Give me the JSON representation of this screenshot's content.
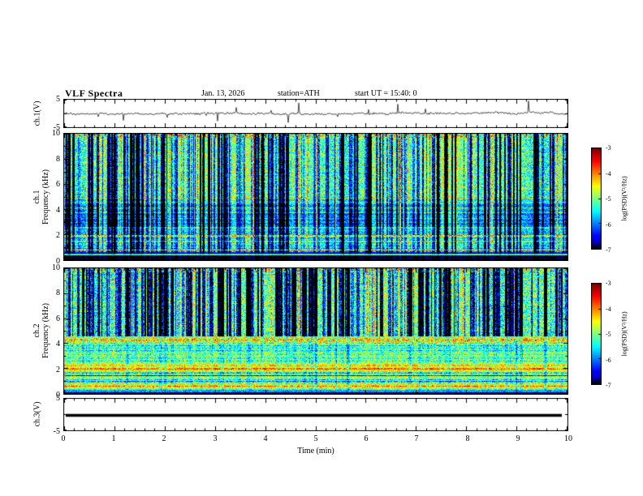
{
  "header": {
    "title": "VLF Spectra",
    "date": "Jan. 13, 2026",
    "station": "station=ATH",
    "start_ut": "start UT =  15:40: 0"
  },
  "xaxis": {
    "label": "Time (min)",
    "ticks": [
      "0",
      "1",
      "2",
      "3",
      "4",
      "5",
      "6",
      "7",
      "8",
      "9",
      "10"
    ],
    "range": [
      0,
      10
    ]
  },
  "panel_ch1v": {
    "label": "ch.1(V)",
    "ytop": "5",
    "ybottom": "-5"
  },
  "panel_spec1": {
    "label_ch": "ch.1",
    "label_freq": "Frequency (kHz)",
    "yticks": [
      "10",
      "8",
      "6",
      "4",
      "2",
      "0"
    ]
  },
  "panel_spec2": {
    "label_ch": "ch.2",
    "label_freq": "Frequency (kHz)",
    "yticks": [
      "10",
      "8",
      "6",
      "4",
      "2",
      "0"
    ]
  },
  "panel_ch3v": {
    "label": "ch.3(V)",
    "ytop": "5",
    "ybottom": "-5"
  },
  "colorbar": {
    "label": "log(PSD)(V²/Hz)",
    "ticks": [
      "-3",
      "-4",
      "-5",
      "-6",
      "-7"
    ],
    "colormap": "jet",
    "zlim": [
      -7,
      -3
    ]
  },
  "chart_data": [
    {
      "type": "line",
      "name": "ch1-voltage-waveform",
      "ylabel": "ch.1(V)",
      "xlabel": "Time (min)",
      "xlim": [
        0,
        10
      ],
      "ylim": [
        -5,
        5
      ],
      "description": "Broadband noisy voltage trace centered on 0 V with intermittent impulsive spikes reaching about ±4 V over 0–10 min",
      "render": {
        "seed": 20260113,
        "noise": 0.32,
        "wander": 0.28,
        "spike_prob": 0.02,
        "spike_amp": 3.4
      }
    },
    {
      "type": "heatmap",
      "name": "ch1-spectrogram",
      "ylabel": "Frequency (kHz)",
      "zlabel": "log(PSD)(V²/Hz)",
      "xlim": [
        0,
        10
      ],
      "ylim": [
        0,
        10
      ],
      "zlim": [
        -7,
        -3
      ],
      "colormap": "jet",
      "description": "VLF power spectral density vs time: green/cyan speckled background with many dark-blue vertical dropout streaks, quieter blue band near 2.6-4.4 kHz, bright horizontal lines near 1.5-2 kHz and 3.7-4.9 kHz, near-black band below 0.3 kHz",
      "render": {
        "seed": 11,
        "bands": [
          [
            9.7,
            10.01,
            0.55,
            0.05,
            0.28
          ],
          [
            5.0,
            9.7,
            0.48,
            0.04,
            0.18
          ],
          [
            4.4,
            5.0,
            0.42,
            0.05,
            0.15
          ],
          [
            2.6,
            4.4,
            0.3,
            0.06,
            0.14
          ],
          [
            1.1,
            2.6,
            0.42,
            0.1,
            0.16
          ],
          [
            0.6,
            1.1,
            0.36,
            0.1,
            0.15
          ],
          [
            0.3,
            0.6,
            0.1,
            0.05,
            0.08
          ],
          [
            0,
            0.3,
            0.02,
            0.01,
            0.02
          ]
        ],
        "hlines": [
          [
            4.9,
            0.22,
            1
          ],
          [
            4.55,
            0.25,
            1
          ],
          [
            4.15,
            0.2,
            1
          ],
          [
            3.75,
            0.18,
            1
          ],
          [
            3.3,
            0.15,
            1
          ],
          [
            1.95,
            0.3,
            2
          ],
          [
            1.5,
            0.28,
            1
          ],
          [
            0.75,
            0.3,
            1
          ],
          [
            0.45,
            0.35,
            2
          ]
        ],
        "dark_streaks": {
          "count": 240,
          "wmin": 1,
          "wmax": 3,
          "smin": 0.18,
          "smax": 0.5
        },
        "bright_streaks": {
          "count": 55,
          "wmin": 1,
          "wmax": 2,
          "smin": 0.1,
          "smax": 0.3
        },
        "pen": [
          [
            0,
            0.6,
            0.1
          ],
          [
            0.6,
            2.6,
            0.75
          ],
          [
            2.6,
            10.01,
            1.0
          ]
        ]
      }
    },
    {
      "type": "heatmap",
      "name": "ch2-spectrogram",
      "ylabel": "Frequency (kHz)",
      "zlabel": "log(PSD)(V²/Hz)",
      "xlim": [
        0,
        10
      ],
      "ylim": [
        0,
        10
      ],
      "zlim": [
        -7,
        -3
      ],
      "colormap": "jet",
      "description": "VLF power spectral density vs time: green speckled background with wide dark vertical streaks above ~4.6 kHz, strong persistent horizontal banding below 4.5 kHz including a yellow band near 2 kHz and an orange band near 4-4.6 kHz, near-black rows at the very bottom",
      "render": {
        "seed": 22,
        "bands": [
          [
            9.7,
            10.01,
            0.55,
            0.05,
            0.28
          ],
          [
            4.6,
            9.7,
            0.47,
            0.04,
            0.2
          ],
          [
            4.0,
            4.6,
            0.6,
            0.06,
            0.22
          ],
          [
            3.3,
            4.0,
            0.45,
            0.08,
            0.16
          ],
          [
            2.4,
            3.3,
            0.5,
            0.08,
            0.16
          ],
          [
            1.75,
            2.4,
            0.66,
            0.06,
            0.14
          ],
          [
            0.8,
            1.75,
            0.48,
            0.12,
            0.16
          ],
          [
            0.3,
            0.8,
            0.55,
            0.12,
            0.16
          ],
          [
            0.12,
            0.3,
            0.25,
            0.08,
            0.1
          ],
          [
            0,
            0.12,
            0.03,
            0.01,
            0.03
          ]
        ],
        "hlines": [
          [
            4.3,
            0.1,
            2
          ],
          [
            3.0,
            0.1,
            1
          ],
          [
            2.0,
            0.14,
            2
          ],
          [
            1.4,
            -0.22,
            1
          ],
          [
            1.0,
            -0.25,
            1
          ],
          [
            0.6,
            0.15,
            1
          ]
        ],
        "dark_streaks": {
          "count": 210,
          "wmin": 1,
          "wmax": 4,
          "smin": 0.2,
          "smax": 0.6
        },
        "bright_streaks": {
          "count": 45,
          "wmin": 1,
          "wmax": 2,
          "smin": 0.12,
          "smax": 0.35
        },
        "pen": [
          [
            0,
            0.3,
            0.0
          ],
          [
            0.3,
            4.6,
            0.12
          ],
          [
            4.6,
            10.01,
            1.0
          ]
        ]
      }
    },
    {
      "type": "line",
      "name": "ch3-voltage-waveform",
      "ylabel": "ch.3(V)",
      "xlabel": "Time (min)",
      "xlim": [
        0,
        10
      ],
      "ylim": [
        -5,
        5
      ],
      "description": "Completely flat thick line at 0 V (channel inactive)",
      "render": {
        "flat": true
      }
    }
  ]
}
